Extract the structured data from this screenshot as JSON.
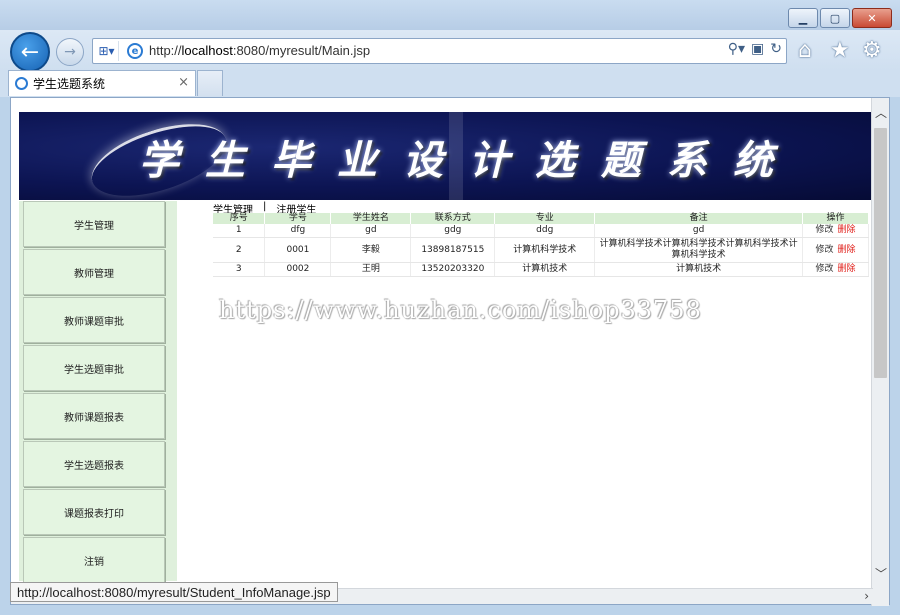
{
  "browser": {
    "url_prefix": "http://",
    "url_host": "localhost",
    "url_rest": ":8080/myresult/Main.jsp",
    "tab_title": "学生选题系统",
    "status_url": "http://localhost:8080/myresult/Student_InfoManage.jsp",
    "icons": [
      "back-icon",
      "forward-icon",
      "compat-view-icon",
      "search-icon",
      "refresh-icon",
      "home-icon",
      "favorites-icon",
      "gear-icon",
      "close-icon"
    ]
  },
  "banner": {
    "title": "学生毕业设计选题系统"
  },
  "menu": {
    "items": [
      {
        "label": "学生管理"
      },
      {
        "label": "教师管理"
      },
      {
        "label": "教师课题审批"
      },
      {
        "label": "学生选题审批"
      },
      {
        "label": "教师课题报表"
      },
      {
        "label": "学生选题报表"
      },
      {
        "label": "课题报表打印"
      },
      {
        "label": "注销"
      }
    ]
  },
  "content": {
    "crumb_manage": "学生管理",
    "crumb_sep": "|",
    "crumb_register": "注册学生",
    "headers": [
      "序号",
      "学号",
      "学生姓名",
      "联系方式",
      "专业",
      "备注",
      "操作"
    ],
    "rows": [
      {
        "idx": "1",
        "sid": "dfg",
        "name": "gd",
        "phone": "gdg",
        "major": "ddg",
        "note": "gd",
        "edit": "修改",
        "del": "删除"
      },
      {
        "idx": "2",
        "sid": "0001",
        "name": "李毅",
        "phone": "13898187515",
        "major": "计算机科学技术",
        "note": "计算机科学技术计算机科学技术计算机科学技术计算机科学技术",
        "edit": "修改",
        "del": "删除"
      },
      {
        "idx": "3",
        "sid": "0002",
        "name": "王明",
        "phone": "13520203320",
        "major": "计算机技术",
        "note": "计算机技术",
        "edit": "修改",
        "del": "删除"
      }
    ]
  },
  "watermark": "https://www.huzhan.com/ishop33758"
}
